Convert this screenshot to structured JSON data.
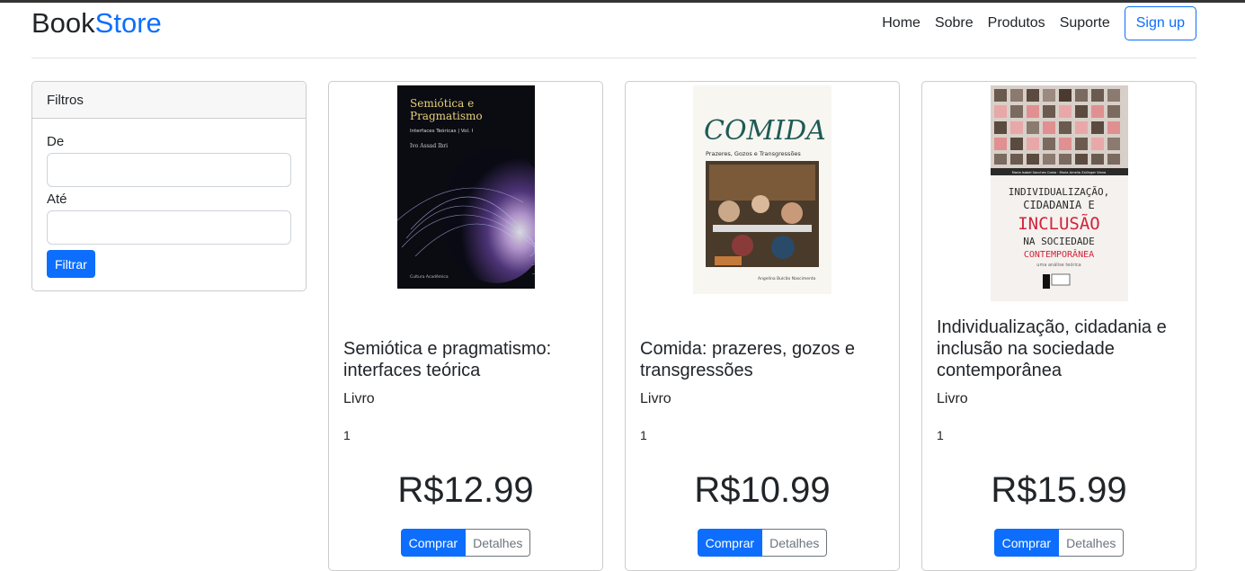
{
  "brand": {
    "part1": "Book",
    "part2": "Store"
  },
  "nav": {
    "items": [
      "Home",
      "Sobre",
      "Produtos",
      "Suporte"
    ],
    "signup": "Sign up"
  },
  "filters": {
    "title": "Filtros",
    "from_label": "De",
    "to_label": "Até",
    "from_value": "",
    "to_value": "",
    "button": "Filtrar"
  },
  "products": [
    {
      "title": "Semiótica e pragmatismo: interfaces teórica",
      "type": "Livro",
      "quantity": "1",
      "price": "R$12.99",
      "buy": "Comprar",
      "details": "Detalhes",
      "cover": {
        "title_line1": "Semiótica e",
        "title_line2": "Pragmatismo",
        "subtitle": "Interfaces Teóricas | Vol. I",
        "author": "Ivo Assad Ibri",
        "publisher": "Cultura Acadêmica"
      }
    },
    {
      "title": "Comida: prazeres, gozos e transgressões",
      "type": "Livro",
      "quantity": "1",
      "price": "R$10.99",
      "buy": "Comprar",
      "details": "Detalhes",
      "cover": {
        "title": "COMIDA",
        "subtitle": "Prazeres, Gozos e Transgressões",
        "author": "Angelina Bulcão Nascimento"
      }
    },
    {
      "title": "Individualização, cidadania e inclusão na sociedade contemporânea",
      "type": "Livro",
      "quantity": "1",
      "price": "R$15.99",
      "buy": "Comprar",
      "details": "Detalhes",
      "cover": {
        "authors": "Maria Isabel Sanches Costa · Maria Amelia Zollinger Viana",
        "line1": "INDIVIDUALIZAÇÃO,",
        "line2": "CIDADANIA E",
        "line3": "INCLUSÃO",
        "line4": "NA SOCIEDADE",
        "line5": "CONTEMPORÂNEA",
        "line6": "uma análise teórica"
      }
    }
  ],
  "colors": {
    "primary": "#0d6efd",
    "text": "#212529",
    "border": "#cccccc",
    "muted": "#6c757d"
  }
}
